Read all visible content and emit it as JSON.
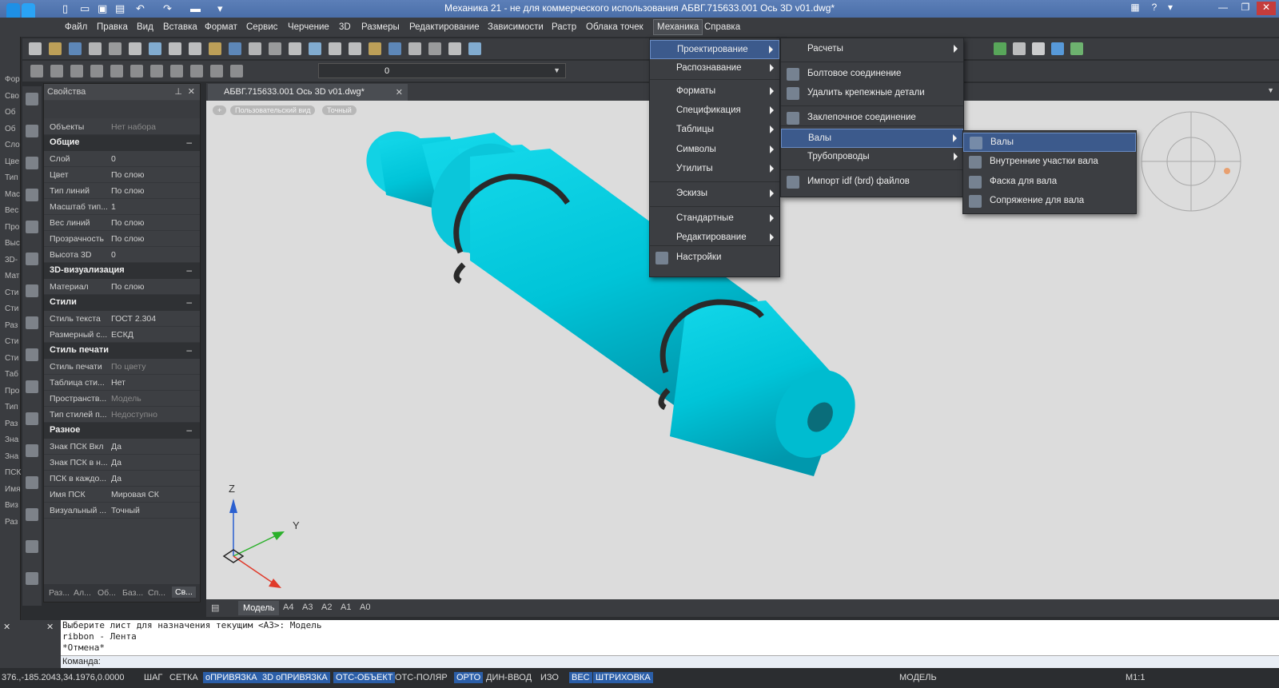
{
  "window": {
    "title": "Механика 21 - не для коммерческого использования АБВГ.715633.001 Ось 3D v01.dwg*",
    "help_label": "?"
  },
  "menubar": {
    "items": [
      "Файл",
      "Правка",
      "Вид",
      "Вставка",
      "Формат",
      "Сервис",
      "Черчение",
      "3D",
      "Размеры",
      "Редактирование",
      "Зависимости",
      "Растр",
      "Облака точек",
      "Механика",
      "Справка"
    ],
    "active": "Механика"
  },
  "layer_combo": {
    "value": "0"
  },
  "left_strip": {
    "labels": [
      "Фор",
      "Сво",
      "Об",
      "Об",
      "Сло",
      "Цве",
      "Тип",
      "Мас",
      "Вес",
      "Про",
      "Выс",
      "3D-",
      "Мат",
      "Сти",
      "Сти",
      "Раз",
      "Сти",
      "Сти",
      "Таб",
      "Про",
      "Тип",
      "Раз",
      "Зна",
      "Зна",
      "ПСК",
      "Имя",
      "Виз",
      "Раз"
    ]
  },
  "properties": {
    "header": "Свойства",
    "objects_label": "Объекты",
    "objects_value": "Нет набора",
    "sections": [
      {
        "title": "Общие",
        "rows": [
          {
            "k": "Слой",
            "v": "0"
          },
          {
            "k": "Цвет",
            "v": "По слою"
          },
          {
            "k": "Тип линий",
            "v": "По слою"
          },
          {
            "k": "Масштаб тип...",
            "v": "1"
          },
          {
            "k": "Вес линий",
            "v": "По слою"
          },
          {
            "k": "Прозрачность",
            "v": "По слою"
          },
          {
            "k": "Высота 3D",
            "v": "0"
          }
        ]
      },
      {
        "title": "3D-визуализация",
        "rows": [
          {
            "k": "Материал",
            "v": "По слою"
          }
        ]
      },
      {
        "title": "Стили",
        "rows": [
          {
            "k": "Стиль текста",
            "v": "ГОСТ 2.304"
          },
          {
            "k": "Размерный с...",
            "v": "ЕСКД"
          }
        ]
      },
      {
        "title": "Стиль печати",
        "rows": [
          {
            "k": "Стиль печати",
            "v": "По цвету",
            "dim": true
          },
          {
            "k": "Таблица сти...",
            "v": "Нет"
          },
          {
            "k": "Пространств...",
            "v": "Модель",
            "dim": true
          },
          {
            "k": "Тип стилей п...",
            "v": "Недоступно",
            "dim": true
          }
        ]
      },
      {
        "title": "Разное",
        "rows": [
          {
            "k": "Знак ПСК Вкл",
            "v": "Да"
          },
          {
            "k": "Знак ПСК в н...",
            "v": "Да"
          },
          {
            "k": "ПСК в каждо...",
            "v": "Да"
          },
          {
            "k": "Имя ПСК",
            "v": "Мировая СК"
          },
          {
            "k": "Визуальный ...",
            "v": "Точный"
          }
        ]
      }
    ],
    "collapse_symbol": "–",
    "bottom_tabs": [
      "Раз...",
      "Ал...",
      "Об...",
      "Баз...",
      "Сп...",
      "Св..."
    ]
  },
  "document_tab": {
    "label": "АБВГ.715633.001 Ось 3D v01.dwg*"
  },
  "viewport": {
    "view_labels": [
      "+",
      "Пользовательский вид",
      "Точный"
    ],
    "axes": {
      "z": "Z",
      "y": "Y"
    },
    "colors": {
      "shaft": "#00c8dc",
      "shaft_dark": "#0098ad",
      "ring": "#2a2a2a",
      "background": "#dcdcdc"
    }
  },
  "layout_tabs": [
    "Модель",
    "A4",
    "A3",
    "A2",
    "A1",
    "A0"
  ],
  "command_line": {
    "lines": [
      "Выберите лист для назначения текущим <А3>: Модель",
      "ribbon - Лента",
      "*Отмена*"
    ],
    "prompt": "Команда:"
  },
  "status_bar": {
    "coords": "376.,-185.2043,34.1976,0.0000",
    "toggles": [
      {
        "label": "ШАГ",
        "on": false
      },
      {
        "label": "СЕТКА",
        "on": false
      },
      {
        "label": "оПРИВЯЗКА",
        "on": true
      },
      {
        "label": "3D оПРИВЯЗКА",
        "on": true
      },
      {
        "label": "ОТС-ОБЪЕКТ",
        "on": true
      },
      {
        "label": "ОТС-ПОЛЯР",
        "on": false
      },
      {
        "label": "ОРТО",
        "on": true
      },
      {
        "label": "ДИН-ВВОД",
        "on": false
      },
      {
        "label": "ИЗО",
        "on": false
      },
      {
        "label": "ВЕС",
        "on": true
      },
      {
        "label": "ШТРИХОВКА",
        "on": true
      }
    ],
    "model": "МОДЕЛЬ",
    "scale": "M1:1"
  },
  "menus": {
    "mechanics": [
      {
        "label": "Проектирование",
        "submenu": true,
        "highlight": true
      },
      {
        "label": "Распознавание",
        "submenu": true
      },
      {
        "label": "Форматы",
        "submenu": true
      },
      {
        "label": "Спецификация",
        "submenu": true
      },
      {
        "label": "Таблицы",
        "submenu": true
      },
      {
        "label": "Символы",
        "submenu": true
      },
      {
        "label": "Утилиты",
        "submenu": true
      },
      {
        "label": "Эскизы",
        "submenu": true
      },
      {
        "label": "Стандартные",
        "submenu": true
      },
      {
        "label": "Редактирование",
        "submenu": true
      },
      {
        "label": "Настройки",
        "submenu": false,
        "icon": "settings-icon"
      }
    ],
    "design": [
      {
        "label": "Расчеты",
        "submenu": true
      },
      {
        "label": "Болтовое соединение",
        "submenu": false,
        "icon": "bolt-icon"
      },
      {
        "label": "Удалить крепежные детали",
        "submenu": false,
        "icon": "remove-fastener-icon"
      },
      {
        "label": "Заклепочное соединение",
        "submenu": false,
        "icon": "rivet-icon"
      },
      {
        "label": "Валы",
        "submenu": true,
        "highlight": true
      },
      {
        "label": "Трубопроводы",
        "submenu": true
      },
      {
        "label": "Импорт idf (brd) файлов",
        "submenu": false,
        "icon": "import-icon"
      }
    ],
    "shafts": [
      {
        "label": "Валы",
        "highlight": true,
        "icon": "shaft-icon"
      },
      {
        "label": "Внутренние участки вала",
        "icon": "inner-shaft-icon"
      },
      {
        "label": "Фаска для вала",
        "icon": "chamfer-icon"
      },
      {
        "label": "Сопряжение для вала",
        "icon": "fillet-icon"
      }
    ]
  }
}
